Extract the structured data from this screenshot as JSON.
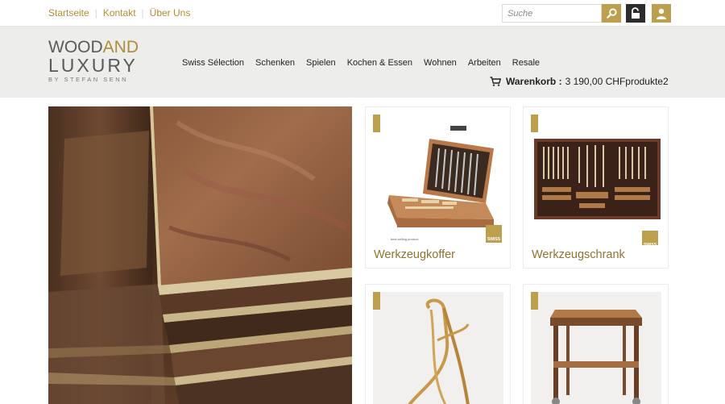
{
  "topnav": {
    "links": [
      "Startseite",
      "Kontakt",
      "Über Uns"
    ],
    "search_placeholder": "Suche"
  },
  "logo": {
    "line1_a": "WOOD",
    "line1_b": "AND",
    "line2": "LUXURY",
    "line3": "BY STEFAN SENN"
  },
  "mainnav": [
    "Swiss Sélection",
    "Schenken",
    "Spielen",
    "Kochen & Essen",
    "Wohnen",
    "Arbeiten",
    "Resale"
  ],
  "cart": {
    "label": "Warenkorb :",
    "value": "3 190,00 CHFprodukte2"
  },
  "products": [
    {
      "title": "Werkzeugkoffer"
    },
    {
      "title": "Werkzeugschrank"
    },
    {
      "title": ""
    },
    {
      "title": ""
    }
  ],
  "icons": [
    "search-icon",
    "lock-icon",
    "user-icon",
    "cart-icon"
  ],
  "colors": {
    "accent": "#bda04e",
    "accent_text": "#b08d35",
    "dark": "#2c2c2c",
    "header_bg": "#ededeb"
  }
}
